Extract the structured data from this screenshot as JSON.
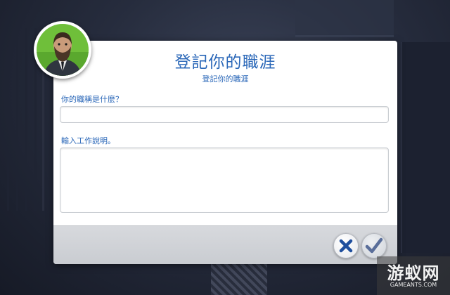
{
  "dialog": {
    "title": "登記你的職涯",
    "subtitle": "登記你的職涯",
    "job_title_label": "你的職稱是什麼？",
    "job_title_value": "",
    "description_label": "輸入工作說明。",
    "description_value": ""
  },
  "buttons": {
    "cancel_icon": "close-x-icon",
    "confirm_icon": "checkmark-icon"
  },
  "watermark": {
    "main": "游蚁网",
    "sub": "GAMEANTS.COM"
  },
  "colors": {
    "accent": "#2a67b8",
    "cancel": "#1f4f9e",
    "confirm": "#5a6e9a"
  }
}
